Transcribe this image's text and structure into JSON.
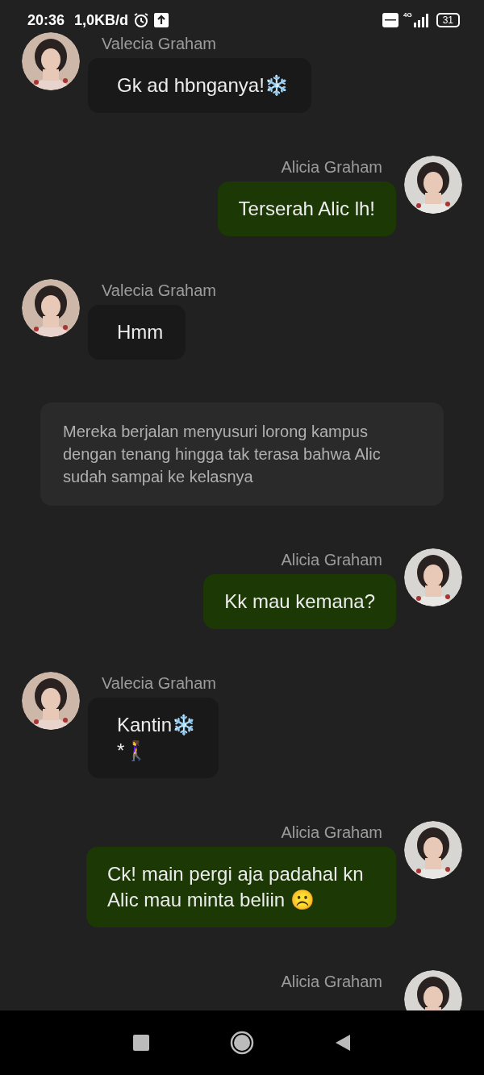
{
  "status_bar": {
    "time": "20:36",
    "speed": "1,0KB/d",
    "network": "4G",
    "battery": "31"
  },
  "messages": [
    {
      "kind": "received",
      "sender": "Valecia Graham",
      "text": "Gk ad hbnganya!❄️"
    },
    {
      "kind": "sent",
      "sender": "Alicia Graham",
      "text": "Terserah Alic lh!"
    },
    {
      "kind": "received",
      "sender": "Valecia Graham",
      "text": "Hmm"
    },
    {
      "kind": "narration",
      "text": "Mereka berjalan menyusuri lorong kampus dengan tenang hingga tak terasa bahwa Alic sudah sampai ke kelasnya"
    },
    {
      "kind": "sent",
      "sender": "Alicia Graham",
      "text": "Kk mau kemana?"
    },
    {
      "kind": "received",
      "sender": "Valecia Graham",
      "text": "Kantin❄️\n*🚶‍♀️"
    },
    {
      "kind": "sent",
      "sender": "Alicia Graham",
      "text": "Ck! main pergi aja padahal kn Alic mau minta beliin ☹️"
    },
    {
      "kind": "sent",
      "sender": "Alicia Graham"
    }
  ]
}
